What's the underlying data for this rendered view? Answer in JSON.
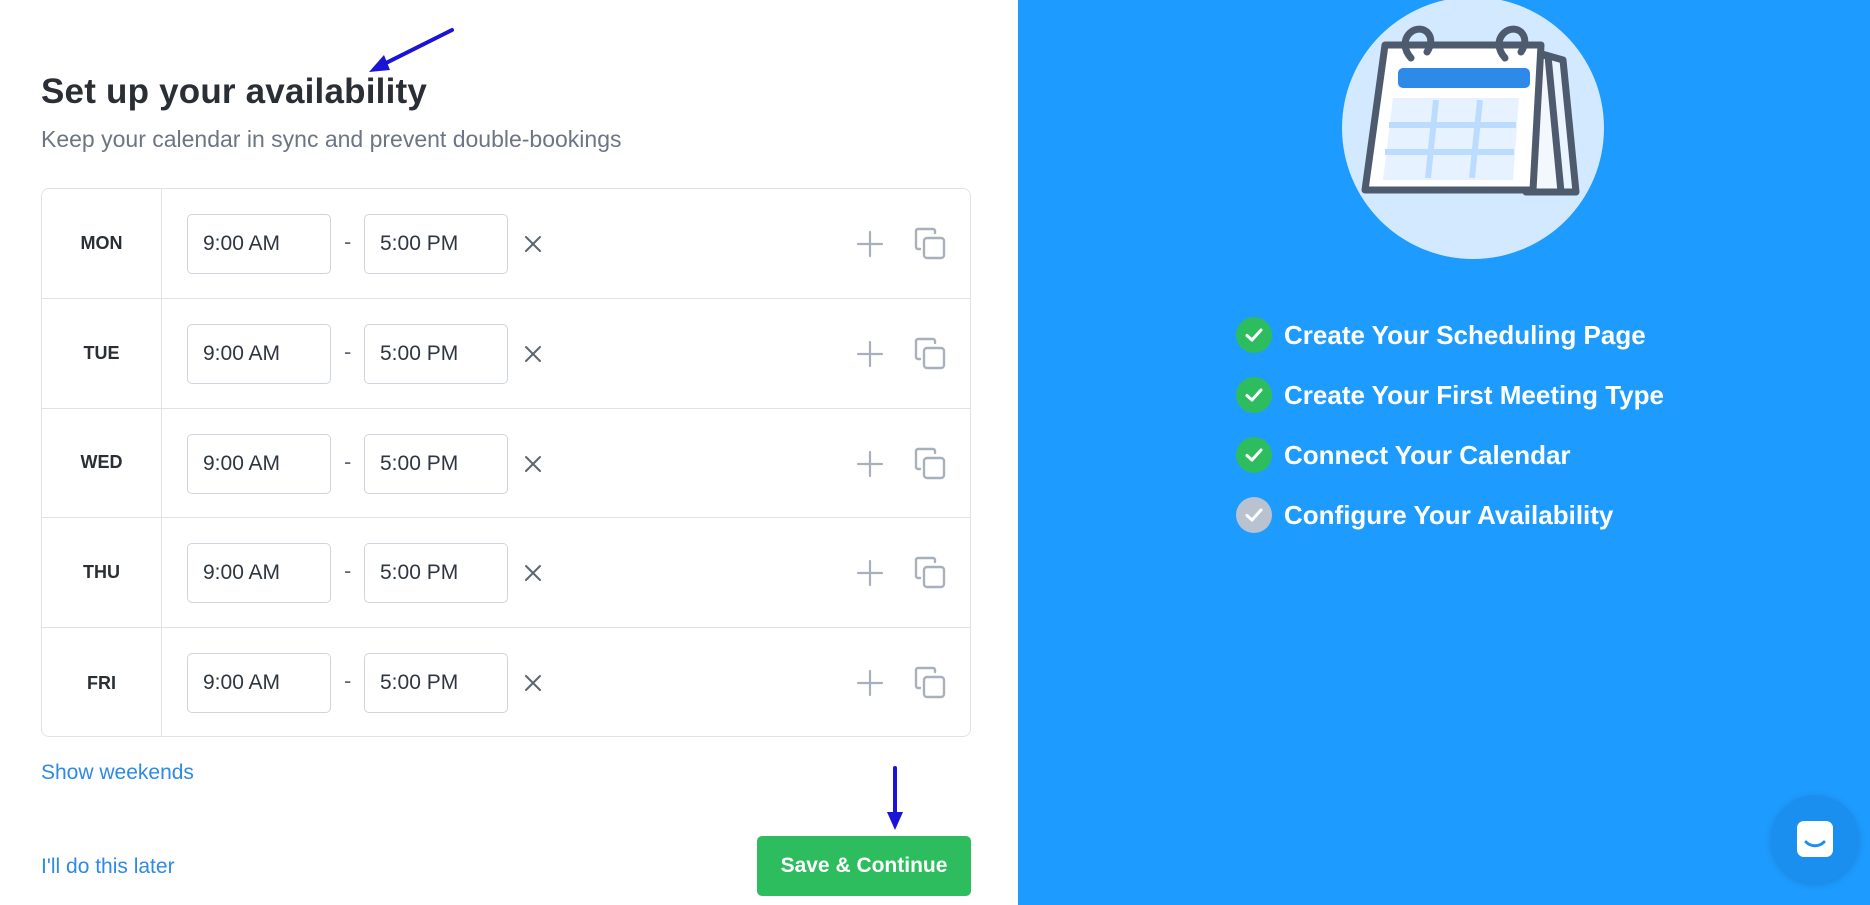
{
  "header": {
    "title": "Set up your availability",
    "subtitle": "Keep your calendar in sync and prevent double-bookings"
  },
  "schedule": {
    "separator": "-",
    "rows": [
      {
        "day": "MON",
        "start": "9:00 AM",
        "end": "5:00 PM"
      },
      {
        "day": "TUE",
        "start": "9:00 AM",
        "end": "5:00 PM"
      },
      {
        "day": "WED",
        "start": "9:00 AM",
        "end": "5:00 PM"
      },
      {
        "day": "THU",
        "start": "9:00 AM",
        "end": "5:00 PM"
      },
      {
        "day": "FRI",
        "start": "9:00 AM",
        "end": "5:00 PM"
      }
    ],
    "icons": {
      "remove": "close-icon",
      "add": "plus-icon",
      "copy": "copy-icon"
    }
  },
  "footer": {
    "show_weekends": "Show weekends",
    "skip": "I'll do this later",
    "save": "Save & Continue"
  },
  "onboarding": {
    "steps": [
      {
        "label": "Create Your Scheduling Page",
        "status": "done"
      },
      {
        "label": "Create Your First Meeting Type",
        "status": "done"
      },
      {
        "label": "Connect Your Calendar",
        "status": "done"
      },
      {
        "label": "Configure Your Availability",
        "status": "pending"
      }
    ]
  },
  "colors": {
    "accent_blue": "#1e9bff",
    "success_green": "#2ebd5e",
    "link_blue": "#2d8ae8",
    "pending_gray": "#b9c3cf",
    "annotation_arrow": "#1a14d6"
  }
}
